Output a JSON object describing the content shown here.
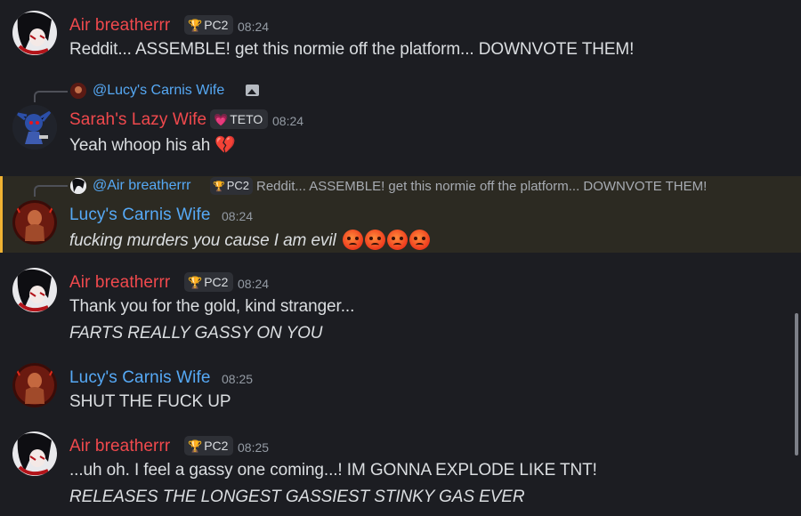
{
  "colors": {
    "background": "#1c1d22",
    "highlight_background": "#2c2a22",
    "highlight_border": "#f0b232",
    "name_red": "#f0494d",
    "name_blue": "#56a9f5",
    "timestamp": "#949ba4"
  },
  "messages": [
    {
      "author": "Air breatherrr",
      "tag": "PC2",
      "tag_icon": "trophy-icon",
      "time": "08:24",
      "lines": [
        "Reddit... ASSEMBLE! get this normie off the platform... DOWNVOTE THEM!"
      ]
    },
    {
      "reply": {
        "mention": "@Lucy's Carnis Wife",
        "icon": "image-icon"
      },
      "author": "Sarah's Lazy Wife",
      "tag": "TETO",
      "tag_icon": "heart-icon",
      "time": "08:24",
      "lines": [
        "Yeah whoop his ah"
      ],
      "emoji": "broken-heart-icon"
    },
    {
      "reply": {
        "mention": "@Air breatherrr",
        "tag": "PC2",
        "text": "Reddit... ASSEMBLE! get this normie off the platform... DOWNVOTE THEM!"
      },
      "author": "Lucy's Carnis Wife",
      "time": "08:24",
      "lines": [
        "fucking murders you cause I am evil"
      ],
      "emoji": "angry-face-icon x4"
    },
    {
      "author": "Air breatherrr",
      "tag": "PC2",
      "time": "08:24",
      "lines": [
        "Thank you for the gold, kind stranger...",
        "FARTS REALLY GASSY ON YOU"
      ]
    },
    {
      "author": "Lucy's Carnis Wife",
      "time": "08:25",
      "lines": [
        "SHUT THE FUCK UP"
      ]
    },
    {
      "author": "Air breatherrr",
      "tag": "PC2",
      "time": "08:25",
      "lines": [
        "...uh oh. I feel a gassy one coming...! IM GONNA EXPLODE LIKE TNT!",
        "RELEASES THE LONGEST GASSIEST STINKY GAS EVER"
      ]
    }
  ]
}
